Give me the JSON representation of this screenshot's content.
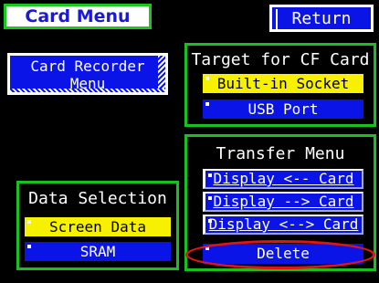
{
  "title": "Card Menu",
  "return_label": "Return",
  "card_recorder": {
    "line1": "Card Recorder",
    "line2": "Menu"
  },
  "target": {
    "title": "Target for CF Card",
    "options": [
      {
        "label": "Built-in Socket",
        "selected": true
      },
      {
        "label": "USB Port",
        "selected": false
      }
    ]
  },
  "transfer": {
    "title": "Transfer Menu",
    "items": [
      "Display <-- Card",
      "Display --> Card",
      "Display <--> Card",
      "Delete"
    ],
    "highlighted_item": "Delete"
  },
  "data_selection": {
    "title": "Data Selection",
    "options": [
      {
        "label": "Screen Data",
        "selected": true
      },
      {
        "label": "SRAM",
        "selected": false
      }
    ]
  },
  "colors": {
    "panel_border": "#17c220",
    "button_blue": "#0a14e6",
    "selected_yellow": "#f7f000",
    "highlight_red": "#e01515"
  }
}
